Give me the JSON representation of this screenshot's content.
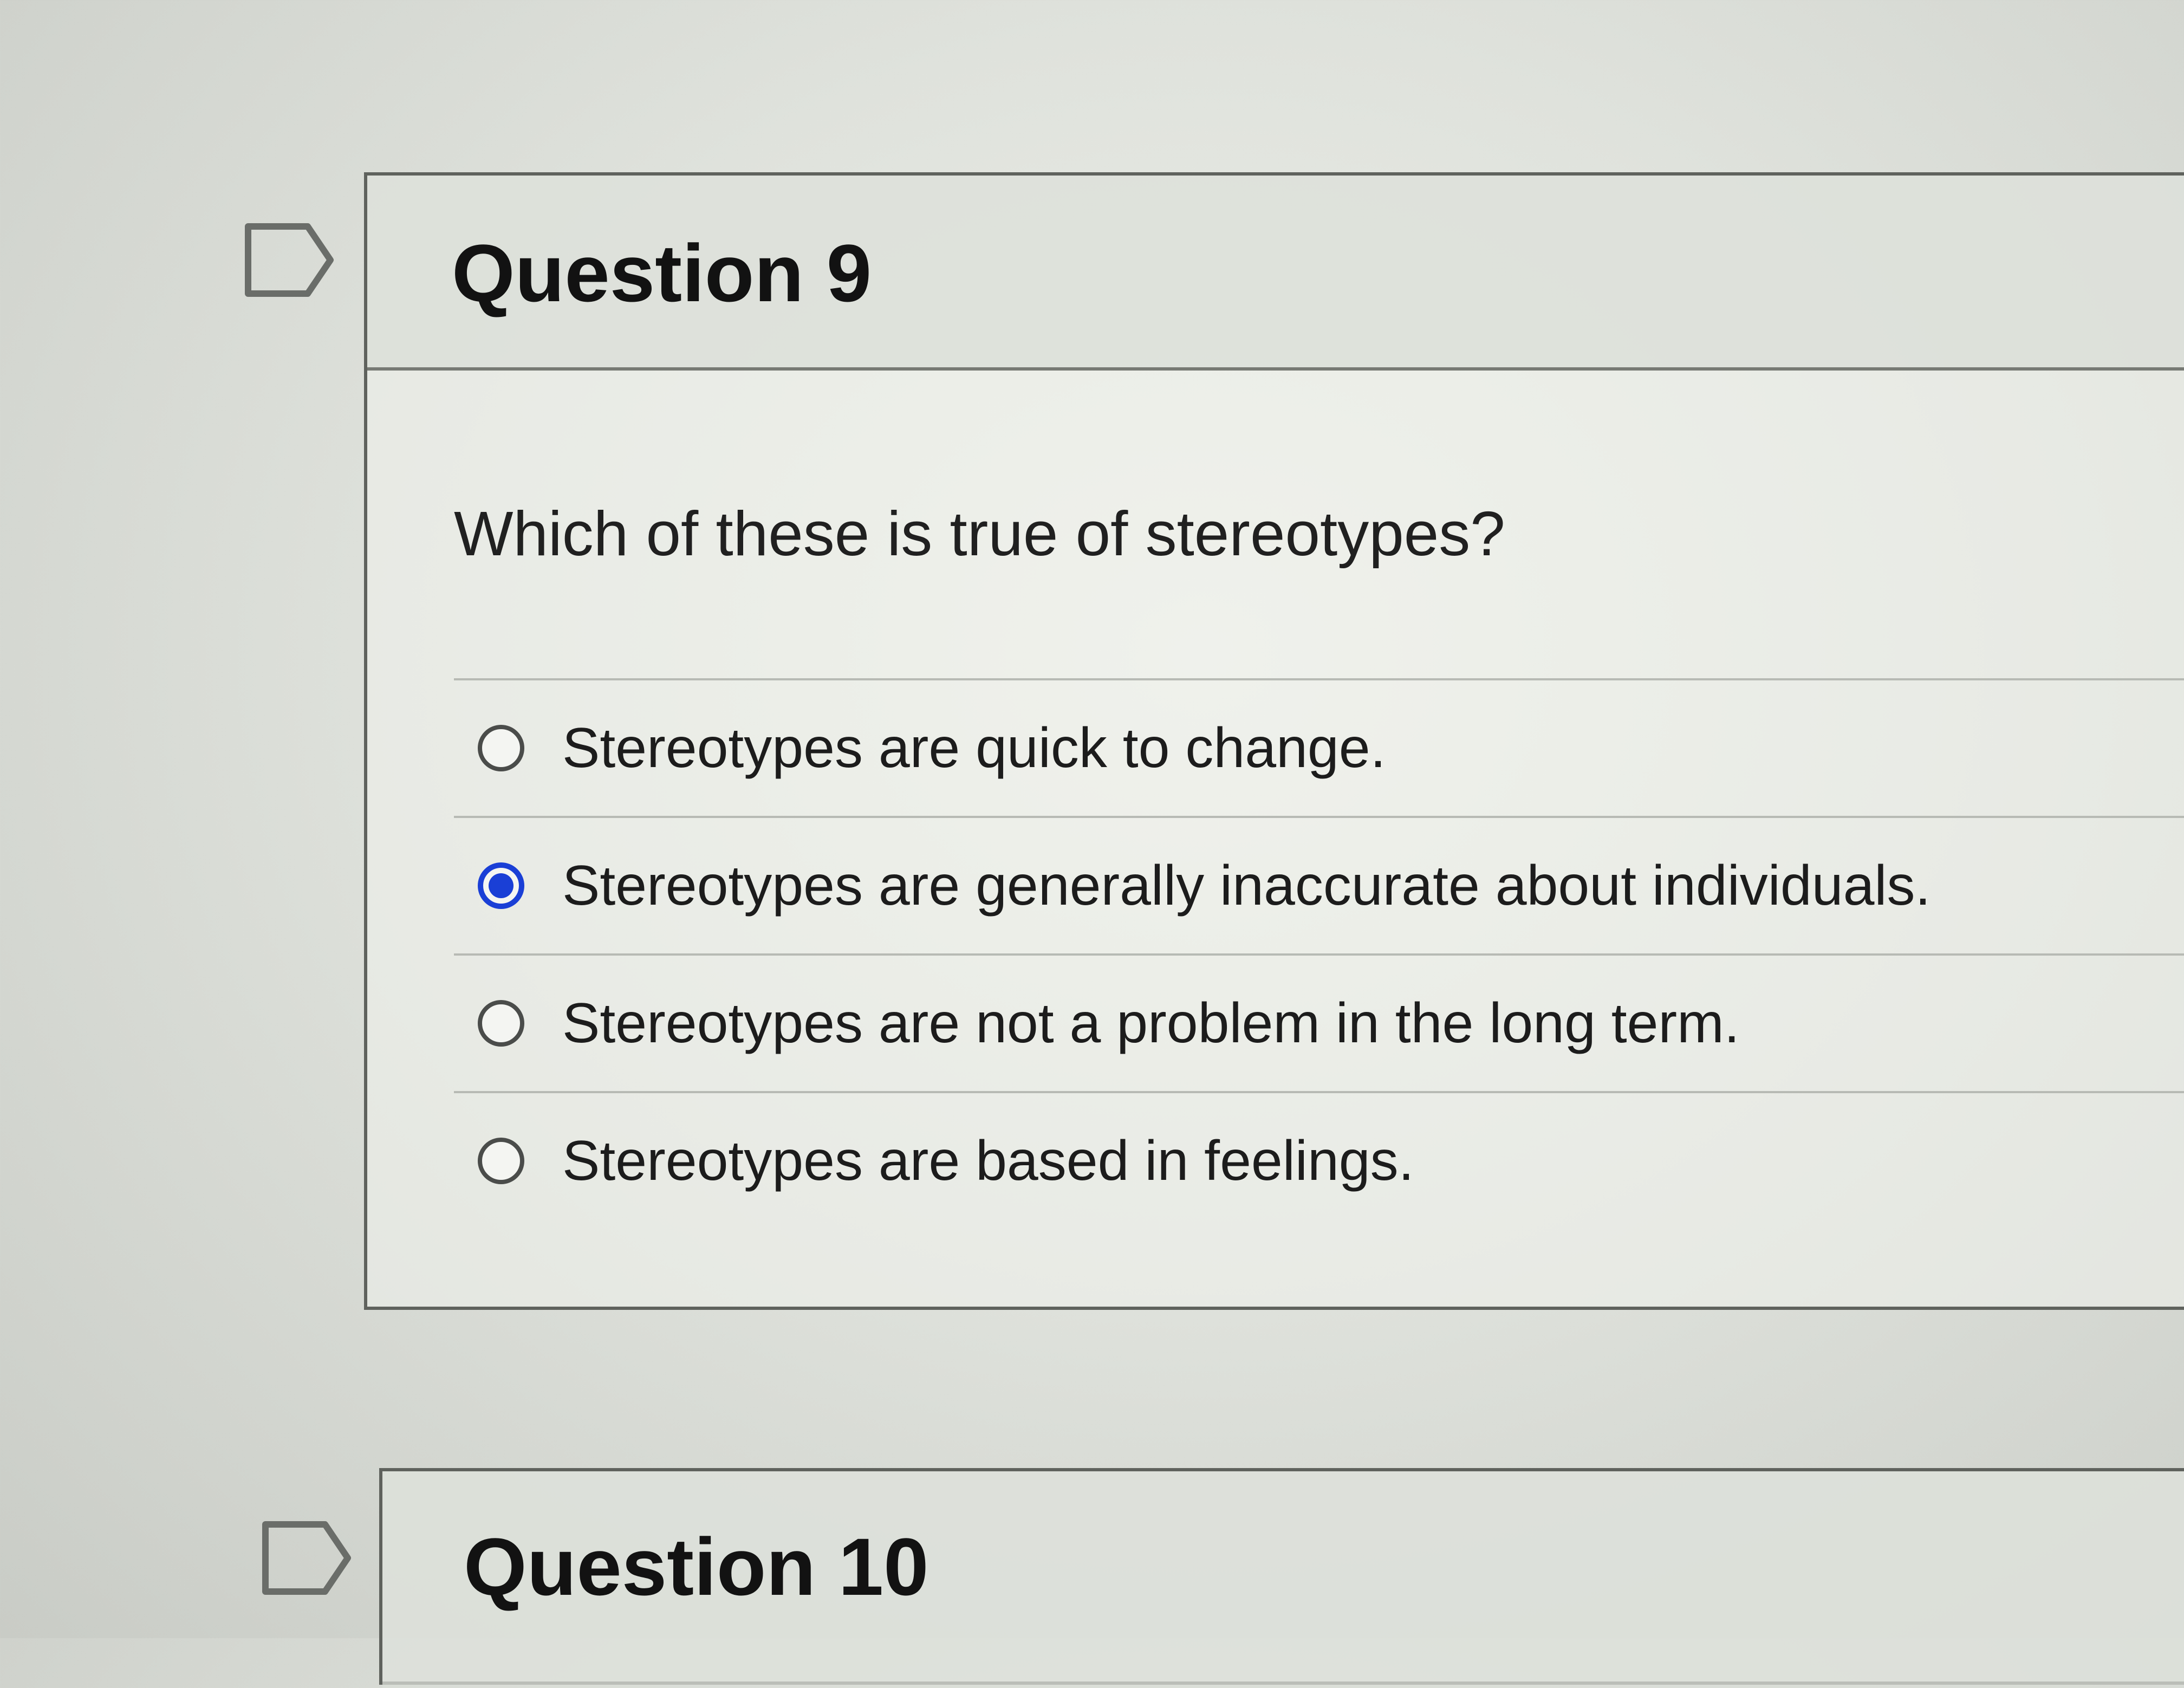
{
  "questions": [
    {
      "title": "Question 9",
      "text": "Which of these is true of stereotypes?",
      "options": [
        {
          "label": "Stereotypes are quick to change.",
          "selected": false
        },
        {
          "label": "Stereotypes are generally inaccurate about individuals.",
          "selected": true
        },
        {
          "label": "Stereotypes are not a problem in the long term.",
          "selected": false
        },
        {
          "label": "Stereotypes are based in feelings.",
          "selected": false
        }
      ]
    },
    {
      "title": "Question 10"
    }
  ],
  "icons": {
    "flag": "flag-outline-icon"
  },
  "colors": {
    "radio_selected": "#1a3fd6",
    "title_text": "#121212"
  }
}
